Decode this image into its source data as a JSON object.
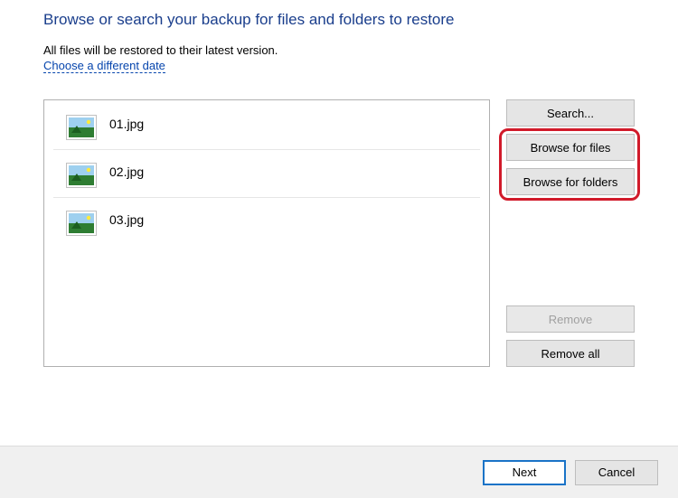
{
  "title": "Browse or search your backup for files and folders to restore",
  "subtitle": "All files will be restored to their latest version.",
  "change_date_link": "Choose a different date",
  "files": [
    {
      "name": "01.jpg"
    },
    {
      "name": "02.jpg"
    },
    {
      "name": "03.jpg"
    }
  ],
  "side": {
    "search": "Search...",
    "browse_files": "Browse for files",
    "browse_folders": "Browse for folders",
    "remove": "Remove",
    "remove_all": "Remove all"
  },
  "footer": {
    "next": "Next",
    "cancel": "Cancel"
  }
}
